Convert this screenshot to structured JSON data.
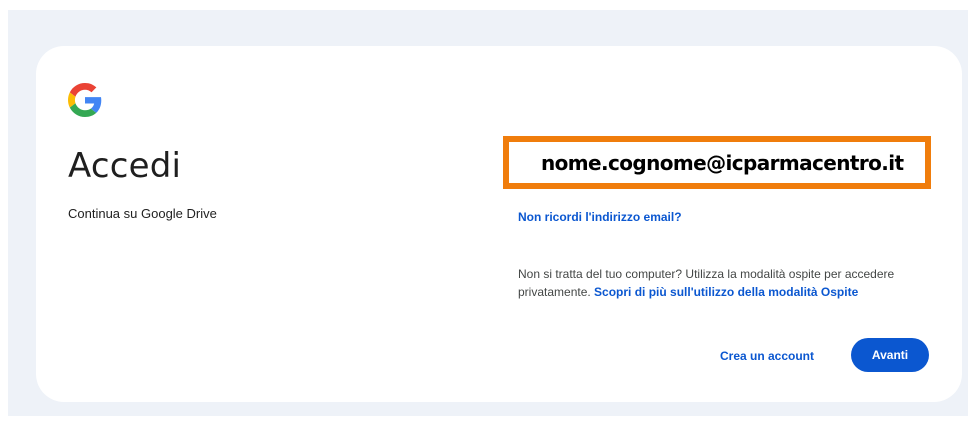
{
  "header": {
    "logo_icon": "google-g-icon",
    "title": "Accedi",
    "subtitle": "Continua su Google Drive"
  },
  "form": {
    "email_value": "nome.cognome@icparmacentro.it",
    "forgot_email_link": "Non ricordi l'indirizzo email?",
    "guest_text": "Non si tratta del tuo computer? Utilizza la modalità ospite per accedere privatamente.",
    "guest_link": "Scopri di più sull'utilizzo della modalità Ospite"
  },
  "actions": {
    "create_account_label": "Crea un account",
    "next_label": "Avanti"
  },
  "colors": {
    "accent": "#0b57d0",
    "highlight_border": "#f07d0c",
    "page_background": "#eef2f8",
    "card_background": "#ffffff"
  }
}
